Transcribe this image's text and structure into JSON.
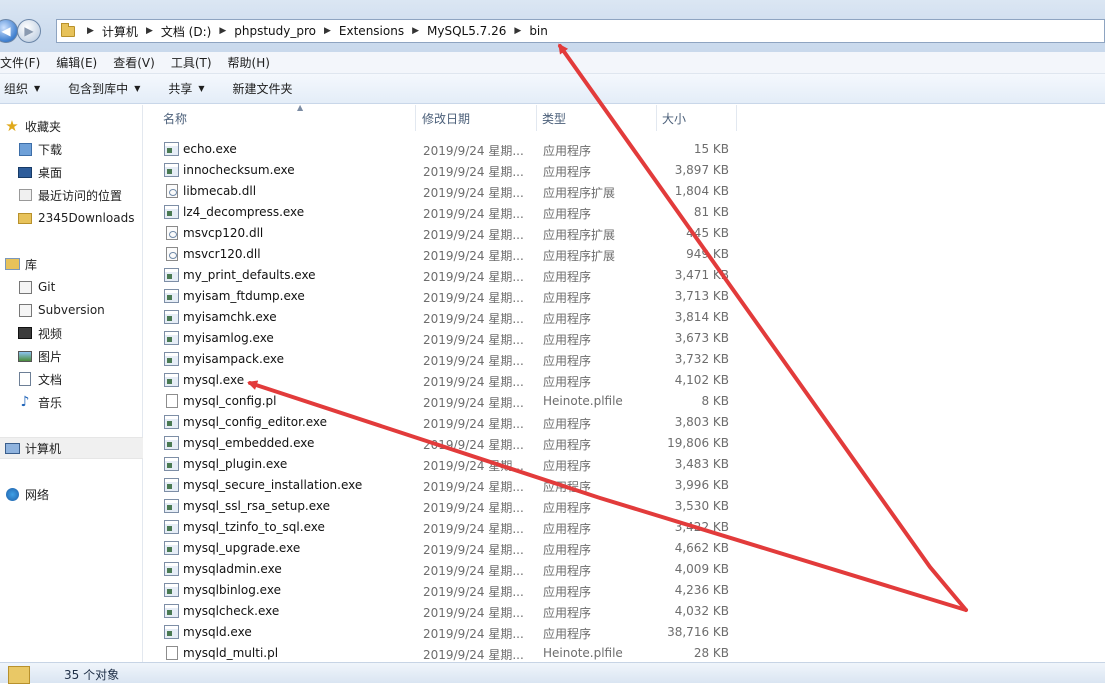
{
  "address_bar": {
    "crumbs": [
      "计算机",
      "文档 (D:)",
      "phpstudy_pro",
      "Extensions",
      "MySQL5.7.26",
      "bin"
    ],
    "sep": "▶"
  },
  "menu": [
    "文件(F)",
    "编辑(E)",
    "查看(V)",
    "工具(T)",
    "帮助(H)"
  ],
  "toolbar": {
    "organize": "组织",
    "include_library": "包含到库中",
    "share": "共享",
    "new_folder": "新建文件夹"
  },
  "nav_pane": {
    "favorites": "收藏夹",
    "downloads": "下载",
    "desktop": "桌面",
    "recent": "最近访问的位置",
    "downloads2345": "2345Downloads",
    "libraries": "库",
    "git": "Git",
    "subversion": "Subversion",
    "videos": "视频",
    "pictures": "图片",
    "documents": "文档",
    "music": "音乐",
    "computer": "计算机",
    "network": "网络"
  },
  "columns": {
    "name": "名称",
    "date": "修改日期",
    "type": "类型",
    "size": "大小"
  },
  "files": [
    {
      "name": "echo.exe",
      "date": "2019/9/24 星期...",
      "type": "应用程序",
      "size": "15 KB",
      "icon": "exe"
    },
    {
      "name": "innochecksum.exe",
      "date": "2019/9/24 星期...",
      "type": "应用程序",
      "size": "3,897 KB",
      "icon": "exe"
    },
    {
      "name": "libmecab.dll",
      "date": "2019/9/24 星期...",
      "type": "应用程序扩展",
      "size": "1,804 KB",
      "icon": "dll"
    },
    {
      "name": "lz4_decompress.exe",
      "date": "2019/9/24 星期...",
      "type": "应用程序",
      "size": "81 KB",
      "icon": "exe"
    },
    {
      "name": "msvcp120.dll",
      "date": "2019/9/24 星期...",
      "type": "应用程序扩展",
      "size": "445 KB",
      "icon": "dll"
    },
    {
      "name": "msvcr120.dll",
      "date": "2019/9/24 星期...",
      "type": "应用程序扩展",
      "size": "949 KB",
      "icon": "dll"
    },
    {
      "name": "my_print_defaults.exe",
      "date": "2019/9/24 星期...",
      "type": "应用程序",
      "size": "3,471 KB",
      "icon": "exe"
    },
    {
      "name": "myisam_ftdump.exe",
      "date": "2019/9/24 星期...",
      "type": "应用程序",
      "size": "3,713 KB",
      "icon": "exe"
    },
    {
      "name": "myisamchk.exe",
      "date": "2019/9/24 星期...",
      "type": "应用程序",
      "size": "3,814 KB",
      "icon": "exe"
    },
    {
      "name": "myisamlog.exe",
      "date": "2019/9/24 星期...",
      "type": "应用程序",
      "size": "3,673 KB",
      "icon": "exe"
    },
    {
      "name": "myisampack.exe",
      "date": "2019/9/24 星期...",
      "type": "应用程序",
      "size": "3,732 KB",
      "icon": "exe"
    },
    {
      "name": "mysql.exe",
      "date": "2019/9/24 星期...",
      "type": "应用程序",
      "size": "4,102 KB",
      "icon": "exe"
    },
    {
      "name": "mysql_config.pl",
      "date": "2019/9/24 星期...",
      "type": "Heinote.plfile",
      "size": "8 KB",
      "icon": "pl"
    },
    {
      "name": "mysql_config_editor.exe",
      "date": "2019/9/24 星期...",
      "type": "应用程序",
      "size": "3,803 KB",
      "icon": "exe"
    },
    {
      "name": "mysql_embedded.exe",
      "date": "2019/9/24 星期...",
      "type": "应用程序",
      "size": "19,806 KB",
      "icon": "exe"
    },
    {
      "name": "mysql_plugin.exe",
      "date": "2019/9/24 星期...",
      "type": "应用程序",
      "size": "3,483 KB",
      "icon": "exe"
    },
    {
      "name": "mysql_secure_installation.exe",
      "date": "2019/9/24 星期...",
      "type": "应用程序",
      "size": "3,996 KB",
      "icon": "exe"
    },
    {
      "name": "mysql_ssl_rsa_setup.exe",
      "date": "2019/9/24 星期...",
      "type": "应用程序",
      "size": "3,530 KB",
      "icon": "exe"
    },
    {
      "name": "mysql_tzinfo_to_sql.exe",
      "date": "2019/9/24 星期...",
      "type": "应用程序",
      "size": "3,422 KB",
      "icon": "exe"
    },
    {
      "name": "mysql_upgrade.exe",
      "date": "2019/9/24 星期...",
      "type": "应用程序",
      "size": "4,662 KB",
      "icon": "exe"
    },
    {
      "name": "mysqladmin.exe",
      "date": "2019/9/24 星期...",
      "type": "应用程序",
      "size": "4,009 KB",
      "icon": "exe"
    },
    {
      "name": "mysqlbinlog.exe",
      "date": "2019/9/24 星期...",
      "type": "应用程序",
      "size": "4,236 KB",
      "icon": "exe"
    },
    {
      "name": "mysqlcheck.exe",
      "date": "2019/9/24 星期...",
      "type": "应用程序",
      "size": "4,032 KB",
      "icon": "exe"
    },
    {
      "name": "mysqld.exe",
      "date": "2019/9/24 星期...",
      "type": "应用程序",
      "size": "38,716 KB",
      "icon": "exe"
    },
    {
      "name": "mysqld_multi.pl",
      "date": "2019/9/24 星期...",
      "type": "Heinote.plfile",
      "size": "28 KB",
      "icon": "pl"
    }
  ],
  "status": {
    "count": "35 个对象"
  },
  "colors": {
    "annotation_arrow": "#e23b3b",
    "accent": "#3f7fcf"
  }
}
